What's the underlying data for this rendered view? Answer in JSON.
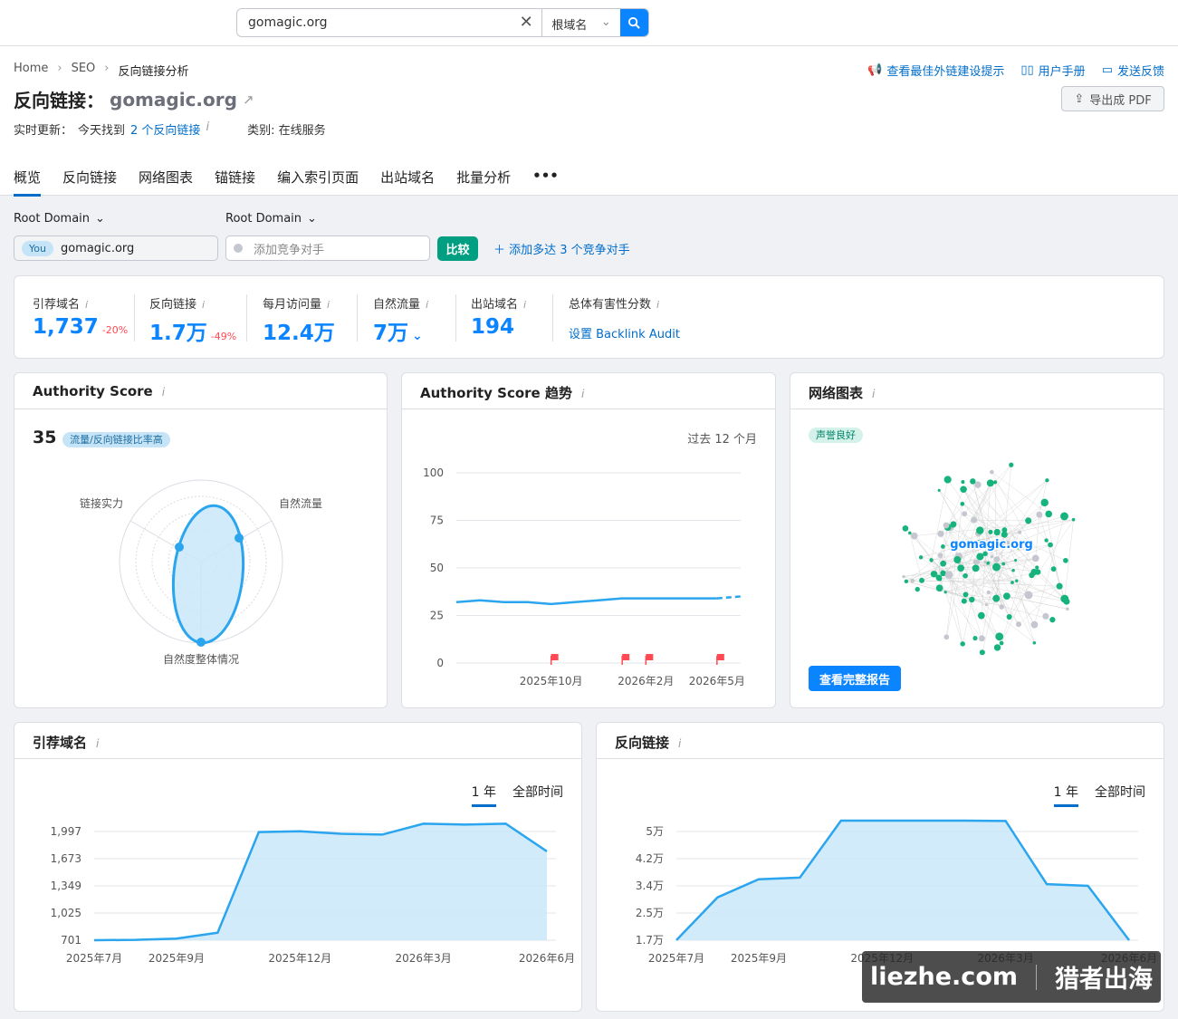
{
  "search": {
    "value": "gomagic.org",
    "scope": "根域名"
  },
  "breadcrumb": [
    "Home",
    "SEO",
    "反向链接分析"
  ],
  "toplinks": [
    "查看最佳外链建设提示",
    "用户手册",
    "发送反馈"
  ],
  "title": {
    "label": "反向链接：",
    "domain": "gomagic.org"
  },
  "pdf_label": "导出成 PDF",
  "meta": {
    "prefix": "实时更新：",
    "found": "今天找到",
    "link": "2 个反向链接",
    "category": "类别: 在线服务"
  },
  "tabs": [
    "概览",
    "反向链接",
    "网络图表",
    "锚链接",
    "编入索引页面",
    "出站域名",
    "批量分析",
    "•••"
  ],
  "selectors": {
    "root1": "Root Domain",
    "root2": "Root Domain",
    "you_badge": "You",
    "you_domain": "gomagic.org",
    "competitor_placeholder": "添加竞争对手",
    "compare": "比较",
    "add_more": "添加多达 3 个竞争对手"
  },
  "metrics": [
    {
      "label": "引荐域名",
      "value": "1,737",
      "change": "-20%"
    },
    {
      "label": "反向链接",
      "value": "1.7万",
      "change": "-49%"
    },
    {
      "label": "每月访问量",
      "value": "12.4万",
      "change": ""
    },
    {
      "label": "自然流量",
      "value": "7万",
      "change": ""
    },
    {
      "label": "出站域名",
      "value": "194",
      "change": ""
    },
    {
      "label": "总体有害性分数",
      "value": "",
      "change": "",
      "link": "设置 Backlink Audit"
    }
  ],
  "authority": {
    "title": "Authority Score",
    "score": "35",
    "tag": "流量/反向链接比率高",
    "axes": [
      "链接实力",
      "自然流量",
      "自然度整体情况"
    ]
  },
  "trend": {
    "title": "Authority Score 趋势",
    "period": "过去 12 个月"
  },
  "network": {
    "title": "网络图表",
    "tag": "声誉良好",
    "domain": "gomagic.org",
    "button": "查看完整报告"
  },
  "referring": {
    "title": "引荐域名",
    "range_on": "1 年",
    "range_off": "全部时间"
  },
  "backlinks": {
    "title": "反向链接",
    "range_on": "1 年",
    "range_off": "全部时间"
  },
  "watermark": {
    "left": "liezhe.com",
    "right": "猎者出海"
  },
  "chart_data": [
    {
      "type": "line",
      "title": "Authority Score 趋势",
      "x": [
        "2025年6月",
        "2025年7月",
        "2025年8月",
        "2025年9月",
        "2025年10月",
        "2025年11月",
        "2025年12月",
        "2026年1月",
        "2026年2月",
        "2026年3月",
        "2026年4月",
        "2026年5月",
        "2026年6月"
      ],
      "series": [
        {
          "values": [
            32,
            33,
            32,
            32,
            31,
            32,
            33,
            34,
            34,
            34,
            34,
            34,
            35
          ]
        }
      ],
      "xticks": [
        "2025年10月",
        "2026年2月",
        "2026年5月"
      ],
      "yticks": [
        0,
        25,
        50,
        75,
        100
      ],
      "ylim": [
        0,
        100
      ],
      "flags": [
        "2025年10月",
        "2026年1月",
        "2026年2月",
        "2026年5月"
      ]
    },
    {
      "type": "area",
      "title": "引荐域名",
      "x": [
        "2025年7月",
        "2025年8月",
        "2025年9月",
        "2025年10月",
        "2025年11月",
        "2025年12月",
        "2026年1月",
        "2026年2月",
        "2026年3月",
        "2026年4月",
        "2026年5月",
        "2026年6月"
      ],
      "series": [
        {
          "values": [
            701,
            705,
            720,
            790,
            1990,
            2000,
            1970,
            1960,
            2090,
            2080,
            2090,
            1760
          ]
        }
      ],
      "xticks": [
        "2025年7月",
        "2025年9月",
        "2025年12月",
        "2026年3月",
        "2026年6月"
      ],
      "yticks": [
        "701",
        "1,025",
        "1,349",
        "1,673",
        "1,997"
      ],
      "ylim": [
        701,
        1997
      ]
    },
    {
      "type": "area",
      "title": "反向链接",
      "x": [
        "2025年7月",
        "2025年8月",
        "2025年9月",
        "2025年10月",
        "2025年11月",
        "2025年12月",
        "2026年1月",
        "2026年2月",
        "2026年3月",
        "2026年4月",
        "2026年5月",
        "2026年6月"
      ],
      "series": [
        {
          "values": [
            17000,
            30000,
            35500,
            36000,
            54000,
            54000,
            54000,
            53500,
            53200,
            34000,
            33500,
            17000
          ]
        }
      ],
      "xticks": [
        "2025年7月",
        "2025年9月",
        "2025年12月",
        "2026年3月",
        "2026年6月"
      ],
      "yticks": [
        "1.7万",
        "2.5万",
        "3.4万",
        "4.2万",
        "5万"
      ],
      "ylim": [
        17000,
        50000
      ]
    }
  ]
}
